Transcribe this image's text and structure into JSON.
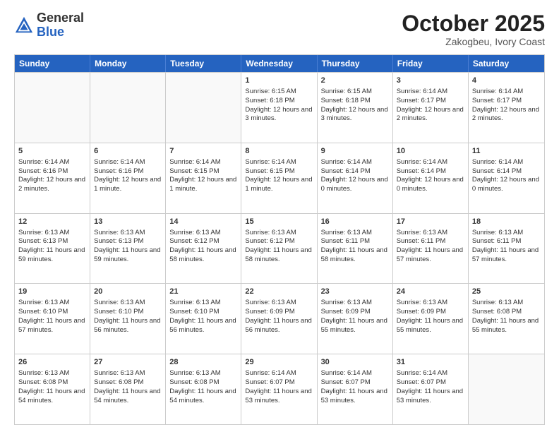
{
  "logo": {
    "general": "General",
    "blue": "Blue"
  },
  "header": {
    "month": "October 2025",
    "location": "Zakogbeu, Ivory Coast"
  },
  "days": [
    "Sunday",
    "Monday",
    "Tuesday",
    "Wednesday",
    "Thursday",
    "Friday",
    "Saturday"
  ],
  "weeks": [
    [
      {
        "day": "",
        "content": ""
      },
      {
        "day": "",
        "content": ""
      },
      {
        "day": "",
        "content": ""
      },
      {
        "day": "1",
        "content": "Sunrise: 6:15 AM\nSunset: 6:18 PM\nDaylight: 12 hours and 3 minutes."
      },
      {
        "day": "2",
        "content": "Sunrise: 6:15 AM\nSunset: 6:18 PM\nDaylight: 12 hours and 3 minutes."
      },
      {
        "day": "3",
        "content": "Sunrise: 6:14 AM\nSunset: 6:17 PM\nDaylight: 12 hours and 2 minutes."
      },
      {
        "day": "4",
        "content": "Sunrise: 6:14 AM\nSunset: 6:17 PM\nDaylight: 12 hours and 2 minutes."
      }
    ],
    [
      {
        "day": "5",
        "content": "Sunrise: 6:14 AM\nSunset: 6:16 PM\nDaylight: 12 hours and 2 minutes."
      },
      {
        "day": "6",
        "content": "Sunrise: 6:14 AM\nSunset: 6:16 PM\nDaylight: 12 hours and 1 minute."
      },
      {
        "day": "7",
        "content": "Sunrise: 6:14 AM\nSunset: 6:15 PM\nDaylight: 12 hours and 1 minute."
      },
      {
        "day": "8",
        "content": "Sunrise: 6:14 AM\nSunset: 6:15 PM\nDaylight: 12 hours and 1 minute."
      },
      {
        "day": "9",
        "content": "Sunrise: 6:14 AM\nSunset: 6:14 PM\nDaylight: 12 hours and 0 minutes."
      },
      {
        "day": "10",
        "content": "Sunrise: 6:14 AM\nSunset: 6:14 PM\nDaylight: 12 hours and 0 minutes."
      },
      {
        "day": "11",
        "content": "Sunrise: 6:14 AM\nSunset: 6:14 PM\nDaylight: 12 hours and 0 minutes."
      }
    ],
    [
      {
        "day": "12",
        "content": "Sunrise: 6:13 AM\nSunset: 6:13 PM\nDaylight: 11 hours and 59 minutes."
      },
      {
        "day": "13",
        "content": "Sunrise: 6:13 AM\nSunset: 6:13 PM\nDaylight: 11 hours and 59 minutes."
      },
      {
        "day": "14",
        "content": "Sunrise: 6:13 AM\nSunset: 6:12 PM\nDaylight: 11 hours and 58 minutes."
      },
      {
        "day": "15",
        "content": "Sunrise: 6:13 AM\nSunset: 6:12 PM\nDaylight: 11 hours and 58 minutes."
      },
      {
        "day": "16",
        "content": "Sunrise: 6:13 AM\nSunset: 6:11 PM\nDaylight: 11 hours and 58 minutes."
      },
      {
        "day": "17",
        "content": "Sunrise: 6:13 AM\nSunset: 6:11 PM\nDaylight: 11 hours and 57 minutes."
      },
      {
        "day": "18",
        "content": "Sunrise: 6:13 AM\nSunset: 6:11 PM\nDaylight: 11 hours and 57 minutes."
      }
    ],
    [
      {
        "day": "19",
        "content": "Sunrise: 6:13 AM\nSunset: 6:10 PM\nDaylight: 11 hours and 57 minutes."
      },
      {
        "day": "20",
        "content": "Sunrise: 6:13 AM\nSunset: 6:10 PM\nDaylight: 11 hours and 56 minutes."
      },
      {
        "day": "21",
        "content": "Sunrise: 6:13 AM\nSunset: 6:10 PM\nDaylight: 11 hours and 56 minutes."
      },
      {
        "day": "22",
        "content": "Sunrise: 6:13 AM\nSunset: 6:09 PM\nDaylight: 11 hours and 56 minutes."
      },
      {
        "day": "23",
        "content": "Sunrise: 6:13 AM\nSunset: 6:09 PM\nDaylight: 11 hours and 55 minutes."
      },
      {
        "day": "24",
        "content": "Sunrise: 6:13 AM\nSunset: 6:09 PM\nDaylight: 11 hours and 55 minutes."
      },
      {
        "day": "25",
        "content": "Sunrise: 6:13 AM\nSunset: 6:08 PM\nDaylight: 11 hours and 55 minutes."
      }
    ],
    [
      {
        "day": "26",
        "content": "Sunrise: 6:13 AM\nSunset: 6:08 PM\nDaylight: 11 hours and 54 minutes."
      },
      {
        "day": "27",
        "content": "Sunrise: 6:13 AM\nSunset: 6:08 PM\nDaylight: 11 hours and 54 minutes."
      },
      {
        "day": "28",
        "content": "Sunrise: 6:13 AM\nSunset: 6:08 PM\nDaylight: 11 hours and 54 minutes."
      },
      {
        "day": "29",
        "content": "Sunrise: 6:14 AM\nSunset: 6:07 PM\nDaylight: 11 hours and 53 minutes."
      },
      {
        "day": "30",
        "content": "Sunrise: 6:14 AM\nSunset: 6:07 PM\nDaylight: 11 hours and 53 minutes."
      },
      {
        "day": "31",
        "content": "Sunrise: 6:14 AM\nSunset: 6:07 PM\nDaylight: 11 hours and 53 minutes."
      },
      {
        "day": "",
        "content": ""
      }
    ]
  ]
}
